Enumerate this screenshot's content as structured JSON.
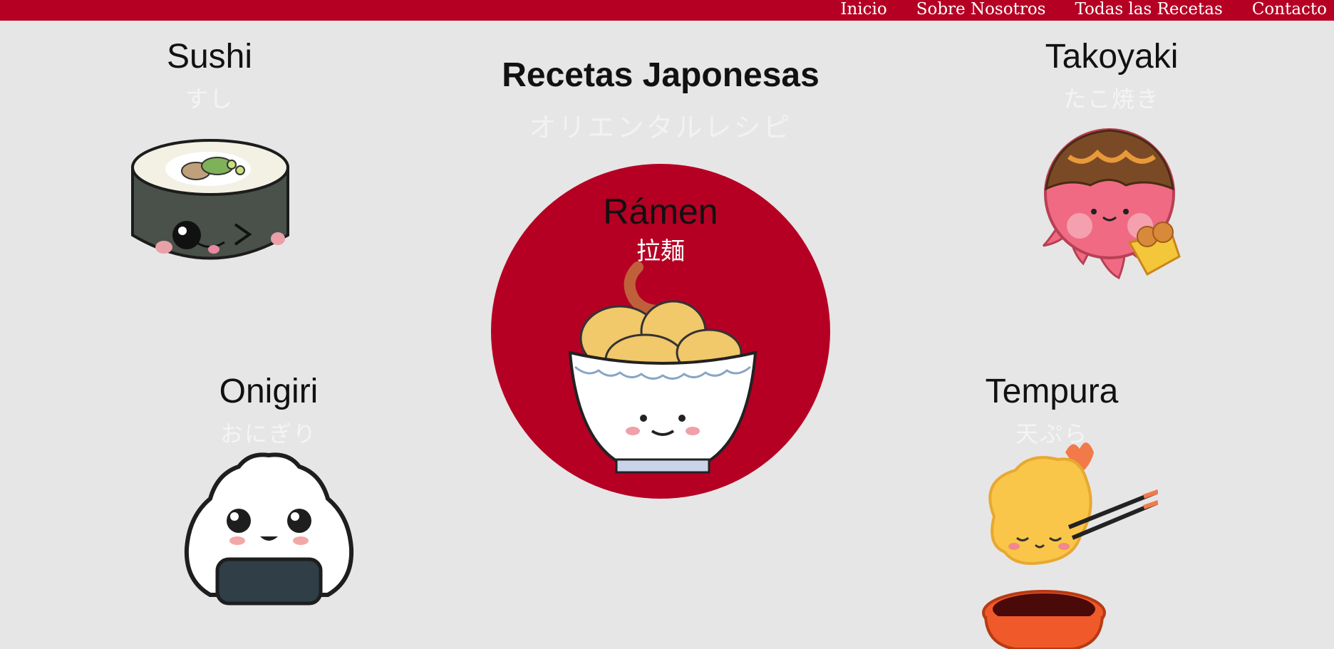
{
  "nav": {
    "items": [
      "Inicio",
      "Sobre Nosotros",
      "Todas las Recetas",
      "Contacto"
    ]
  },
  "hero": {
    "title": "Recetas Japonesas",
    "subtitle": "オリエンタルレシピ"
  },
  "dishes": {
    "sushi": {
      "name": "Sushi",
      "jp": "すし"
    },
    "takoyaki": {
      "name": "Takoyaki",
      "jp": "たこ焼き"
    },
    "ramen": {
      "name": "Rámen",
      "jp": "拉麺"
    },
    "onigiri": {
      "name": "Onigiri",
      "jp": "おにぎり"
    },
    "tempura": {
      "name": "Tempura",
      "jp": "天ぷら"
    }
  },
  "colors": {
    "brand_red": "#b50024",
    "background": "#e6e6e6"
  },
  "icons": [
    "sushi-icon",
    "takoyaki-icon",
    "ramen-bowl-icon",
    "onigiri-icon",
    "tempura-icon"
  ]
}
